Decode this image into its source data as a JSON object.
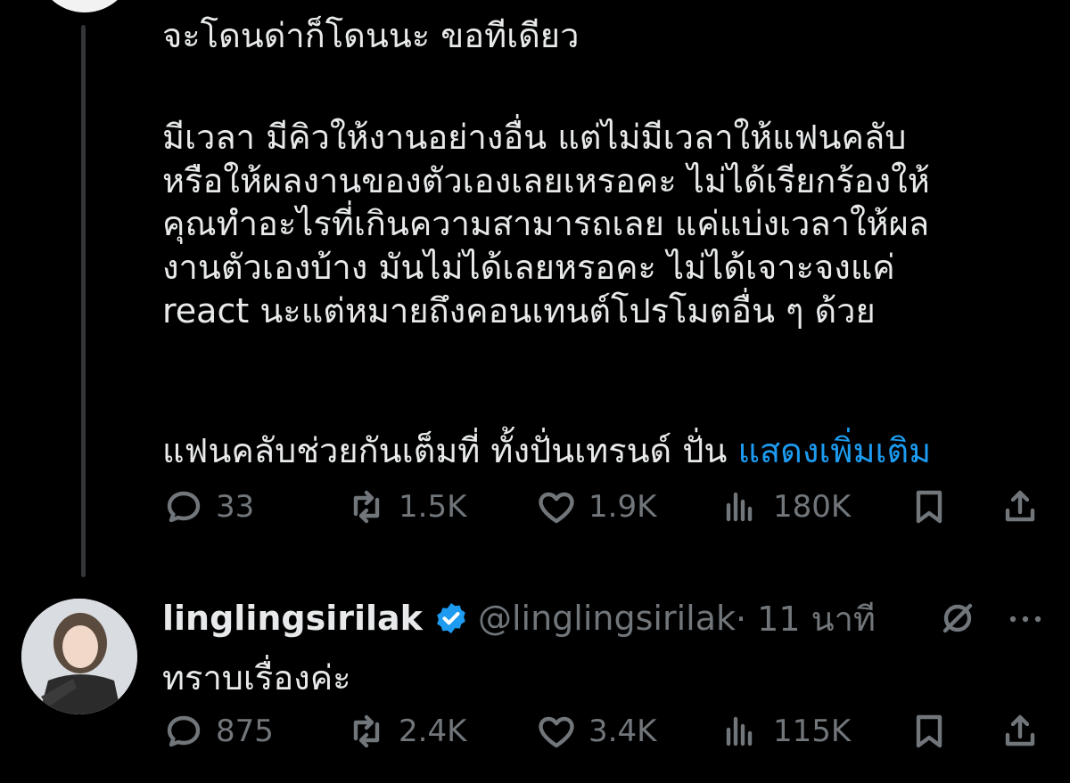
{
  "tweet1": {
    "line1": "จะโดนด่าก็โดนนะ ขอทีเดียว",
    "para2": [
      "มีเวลา มีคิวให้งานอย่างอื่น แต่ไม่มีเวลาให้แฟนคลับ",
      "หรือให้ผลงานของตัวเองเลยเหรอคะ ไม่ได้เรียกร้องให้",
      "คุณทำอะไรที่เกินความสามารถเลย แค่แบ่งเวลาให้ผล",
      "งานตัวเองบ้าง มันไม่ได้เลยหรอคะ ไม่ได้เจาะจงแค่",
      "react นะแต่หมายถึงคอนเทนต์โปรโมตอื่น ๆ ด้วย"
    ],
    "line3": "แฟนคลับช่วยกันเต็มที่ ทั้งปั่นเทรนด์ ปั่น",
    "show_more": "แสดงเพิ่มเติม",
    "replies": "33",
    "retweets": "1.5K",
    "likes": "1.9K",
    "views": "180K"
  },
  "tweet2": {
    "author": "linglingsirilak",
    "handle": "@linglingsirilak",
    "time": "· 11 นาที",
    "text": "ทราบเรื่องค่ะ",
    "replies": "875",
    "retweets": "2.4K",
    "likes": "3.4K",
    "views": "115K"
  },
  "icons": {
    "reply": "reply-icon",
    "retweet": "retweet-icon",
    "like": "heart-icon",
    "views": "views-icon",
    "bookmark": "bookmark-icon",
    "share": "share-icon",
    "verified": "verified-badge-icon",
    "grok": "grok-icon",
    "more": "more-icon"
  },
  "colors": {
    "background": "#000000",
    "text": "#e7e9ea",
    "muted": "#71767b",
    "link": "#1d9bf0"
  }
}
